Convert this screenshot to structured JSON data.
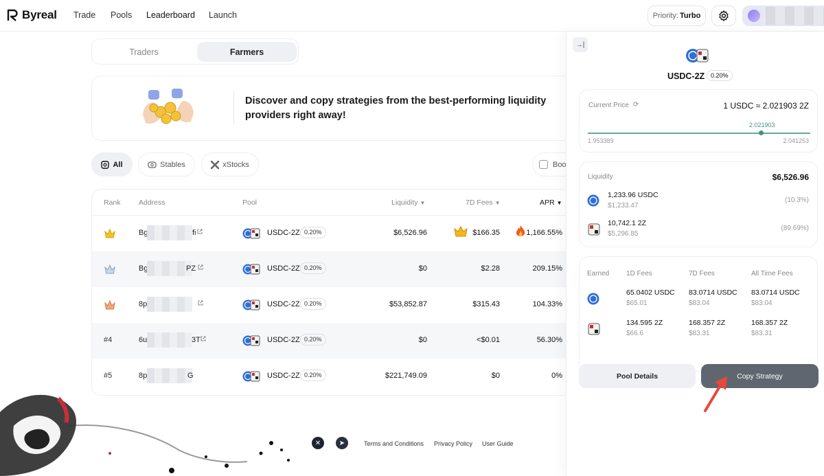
{
  "brand": {
    "name": "Byreal"
  },
  "nav": [
    {
      "label": "Trade"
    },
    {
      "label": "Pools"
    },
    {
      "label": "Leaderboard"
    },
    {
      "label": "Launch"
    }
  ],
  "header": {
    "priority_label": "Priority:",
    "priority_value": "Turbo"
  },
  "tabs": [
    {
      "label": "Traders",
      "active": false
    },
    {
      "label": "Farmers",
      "active": true
    }
  ],
  "banner": {
    "text": "Discover and copy strategies from the best-performing liquidity providers right away!"
  },
  "filters": [
    {
      "label": "All",
      "icon": "grid-icon",
      "active": true
    },
    {
      "label": "Stables",
      "icon": "stables-icon",
      "active": false
    },
    {
      "label": "xStocks",
      "icon": "xstocks-icon",
      "active": false
    }
  ],
  "boost_filter": {
    "label": "Boo"
  },
  "table": {
    "headers": {
      "rank": "Rank",
      "address": "Address",
      "pool": "Pool",
      "liquidity": "Liquidity",
      "fees7d": "7D Fees",
      "apr": "APR"
    },
    "rows": [
      {
        "rank": "",
        "rank_icon": "gold-crown",
        "addr_start": "Bg",
        "addr_end": "fi",
        "pool": "USDC-2Z",
        "fee": "0.20%",
        "liquidity": "$6,526.96",
        "fees7d": "$166.35",
        "apr": "1,166.55%",
        "fees_icon": "crown-icon",
        "apr_icon": "fire-icon"
      },
      {
        "rank": "",
        "rank_icon": "silver-crown",
        "addr_start": "Bg",
        "addr_end": "PZ",
        "pool": "USDC-2Z",
        "fee": "0.20%",
        "liquidity": "$0",
        "fees7d": "$2.28",
        "apr": "209.15%"
      },
      {
        "rank": "",
        "rank_icon": "bronze-crown",
        "addr_start": "8p",
        "addr_end": "",
        "pool": "USDC-2Z",
        "fee": "0.20%",
        "liquidity": "$53,852.87",
        "fees7d": "$315.43",
        "apr": "104.33%"
      },
      {
        "rank": "#4",
        "addr_start": "6u",
        "addr_end": "3T",
        "pool": "USDC-2Z",
        "fee": "0.20%",
        "liquidity": "$0",
        "fees7d": "<$0.01",
        "apr": "56.30%"
      },
      {
        "rank": "#5",
        "addr_start": "8p",
        "addr_end": "G",
        "pool": "USDC-2Z",
        "fee": "0.20%",
        "liquidity": "$221,749.09",
        "fees7d": "$0",
        "apr": "0%"
      }
    ]
  },
  "panel": {
    "pool": "USDC-2Z",
    "fee": "0.20%",
    "current_price_label": "Current Price",
    "current_price": "1 USDC ≈ 2.021903 2Z",
    "range_current": "2.021903",
    "range_min": "1.953389",
    "range_max": "2.041253",
    "range_position": 0.78,
    "liquidity_label": "Liquidity",
    "liquidity_total": "$6,526.96",
    "liquidity_items": [
      {
        "amount": "1,233.96 USDC",
        "usd": "$1,233.47",
        "pct": "(10.3%)",
        "icon": "usdc-icon"
      },
      {
        "amount": "10,742.1 2Z",
        "usd": "$5,296.85",
        "pct": "(89.69%)",
        "icon": "2z-icon"
      }
    ],
    "earned": {
      "headers": [
        "Earned",
        "1D Fees",
        "7D Fees",
        "All Time Fees"
      ],
      "rows": [
        {
          "icon": "usdc-icon",
          "d1": "65.0402 USDC",
          "d1_usd": "$65.01",
          "d7": "83.0714 USDC",
          "d7_usd": "$83.04",
          "all": "83.0714 USDC",
          "all_usd": "$83.04"
        },
        {
          "icon": "2z-icon",
          "d1": "134.595 2Z",
          "d1_usd": "$66.6",
          "d7": "168.357 2Z",
          "d7_usd": "$83.31",
          "all": "168.357 2Z",
          "all_usd": "$83.31"
        }
      ]
    },
    "pool_details_label": "Pool Details",
    "copy_strategy_label": "Copy Strategy"
  },
  "footer": {
    "links": [
      "Terms and Conditions",
      "Privacy Policy",
      "User Guide"
    ]
  },
  "colors": {
    "accent_green": "#3f9484",
    "copy_button": "#5f6670",
    "arrow": "#e8473b"
  }
}
